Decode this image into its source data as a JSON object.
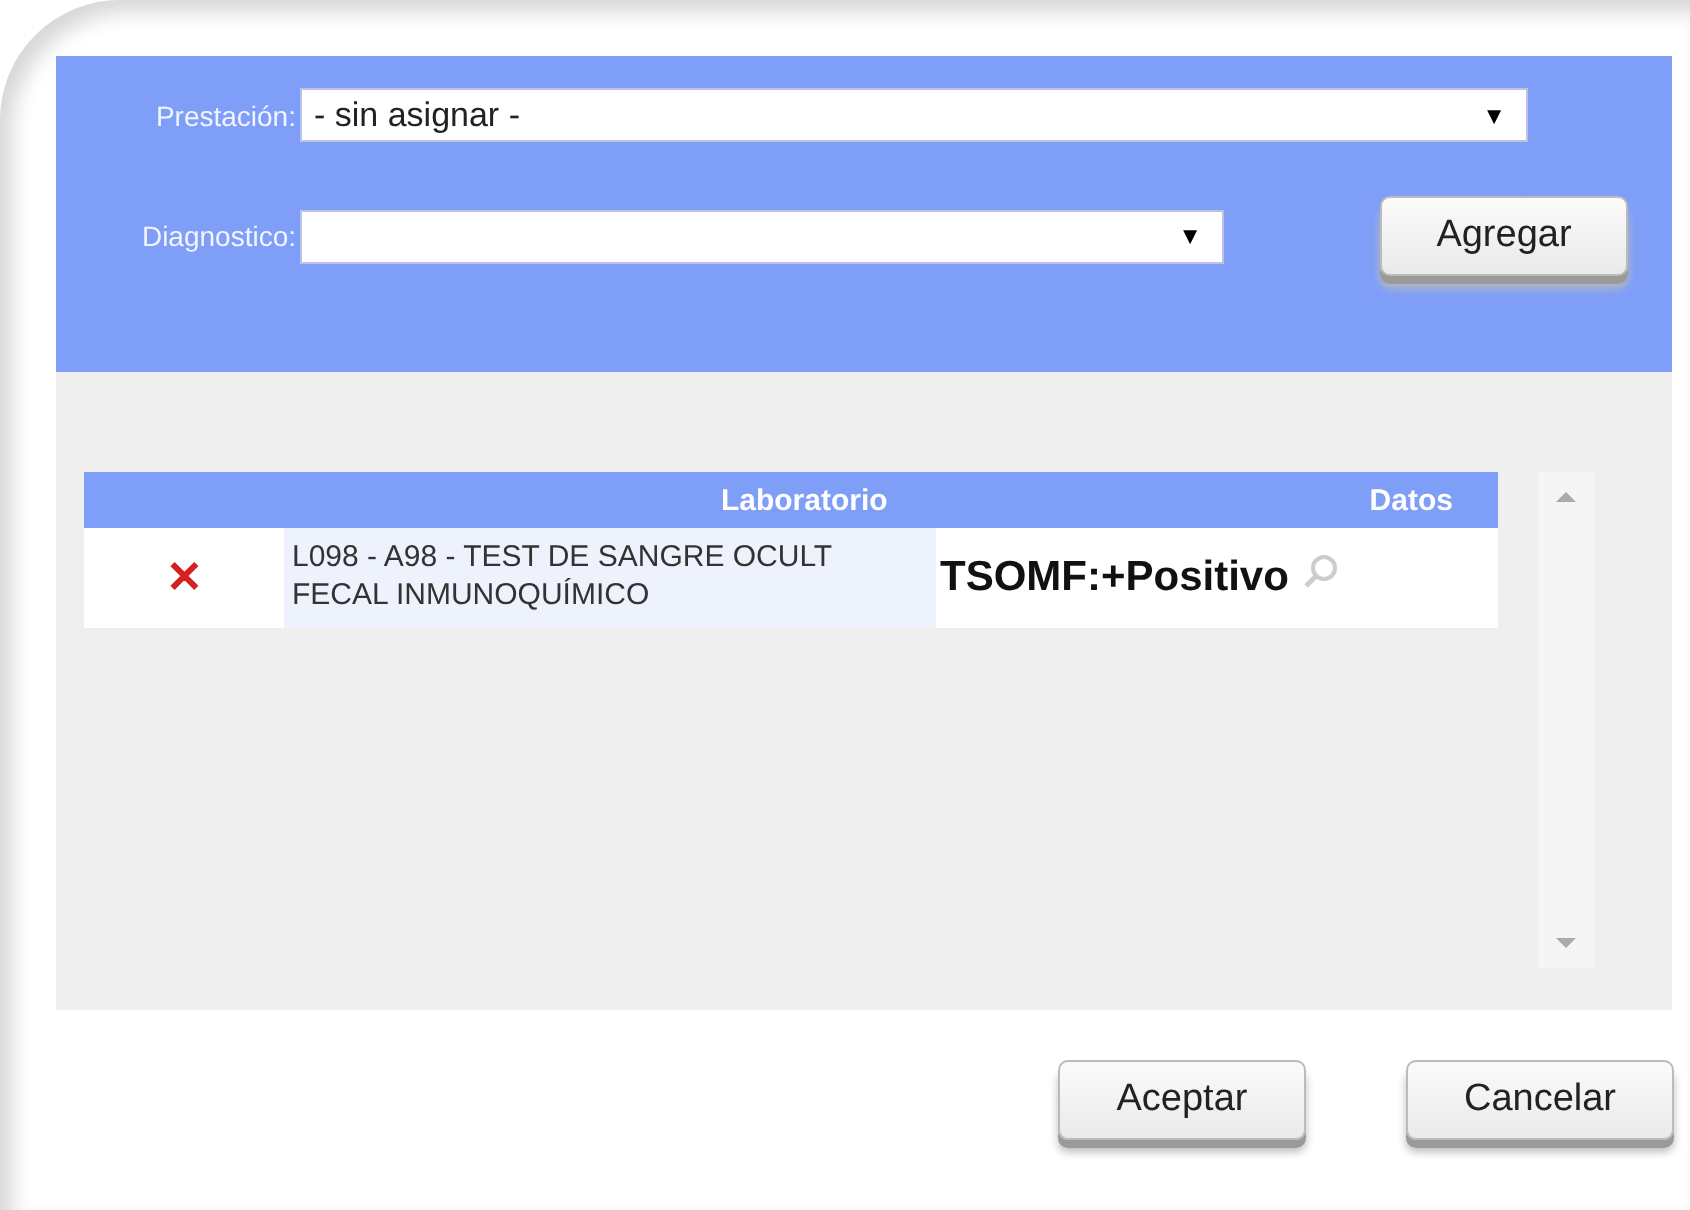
{
  "form": {
    "fields": [
      {
        "label": "Prestación:",
        "value": "- sin asignar -",
        "arrow": "▼",
        "kind": "wide"
      },
      {
        "label": "Diagnostico:",
        "arrow": "▼",
        "kind": "narrow"
      }
    ],
    "add_button": "Agregar"
  },
  "table": {
    "columns": [
      "Laboratorio",
      "Datos"
    ],
    "rows": [
      {
        "delete": "✕",
        "lines": [
          "L098 - A98 - TEST DE SANGRE OCULT",
          "FECAL INMUNOQUÍMICO"
        ],
        "result": "TSOMF:+Positivo"
      }
    ]
  },
  "buttons": [
    "Aceptar",
    "Cancelar"
  ]
}
